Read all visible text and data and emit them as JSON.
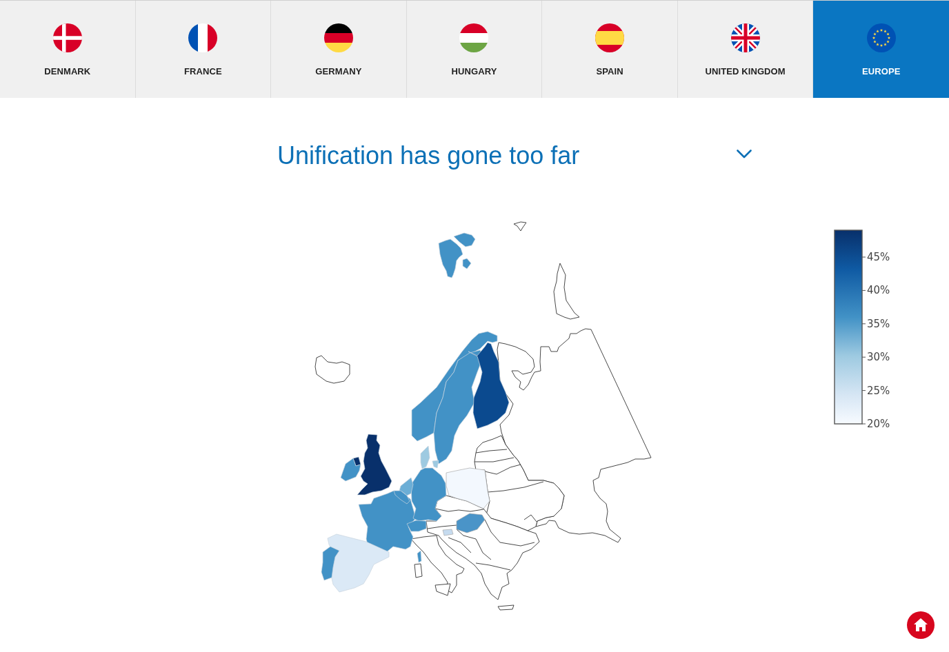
{
  "tabs": [
    {
      "label": "DENMARK",
      "selected": false
    },
    {
      "label": "FRANCE",
      "selected": false
    },
    {
      "label": "GERMANY",
      "selected": false
    },
    {
      "label": "HUNGARY",
      "selected": false
    },
    {
      "label": "SPAIN",
      "selected": false
    },
    {
      "label": "UNITED KINGDOM",
      "selected": false
    },
    {
      "label": "EUROPE",
      "selected": true
    }
  ],
  "question": {
    "title": "Unification has gone too far"
  },
  "colorbar": {
    "ticks": [
      "45%",
      "40%",
      "35%",
      "30%",
      "25%",
      "20%"
    ]
  }
}
